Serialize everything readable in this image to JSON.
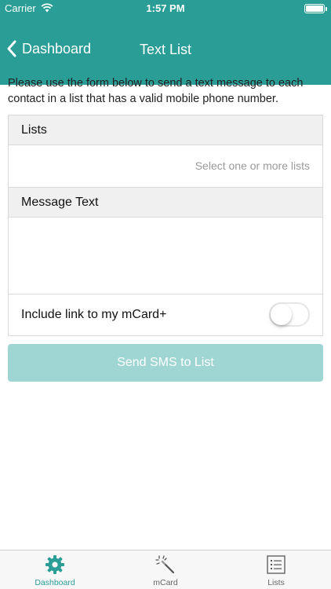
{
  "status_bar": {
    "carrier": "Carrier",
    "time": "1:57 PM"
  },
  "nav": {
    "back_label": "Dashboard",
    "title": "Text List"
  },
  "intro_text": "Please use the form below to send a text message to each contact in a list that has a valid mobile phone number.",
  "form": {
    "lists_header": "Lists",
    "lists_placeholder": "Select one or more lists",
    "message_header": "Message Text",
    "message_value": "",
    "include_link_label": "Include link to my mCard+",
    "include_link_on": false
  },
  "send_button_label": "Send SMS to List",
  "tabs": [
    {
      "label": "Dashboard",
      "icon": "gear-icon",
      "active": true
    },
    {
      "label": "mCard",
      "icon": "magic-wand-icon",
      "active": false
    },
    {
      "label": "Lists",
      "icon": "list-icon",
      "active": false
    }
  ],
  "colors": {
    "brand": "#2a9d96",
    "button_disabled": "#9fd6d4",
    "section_bg": "#f0f0f0"
  }
}
